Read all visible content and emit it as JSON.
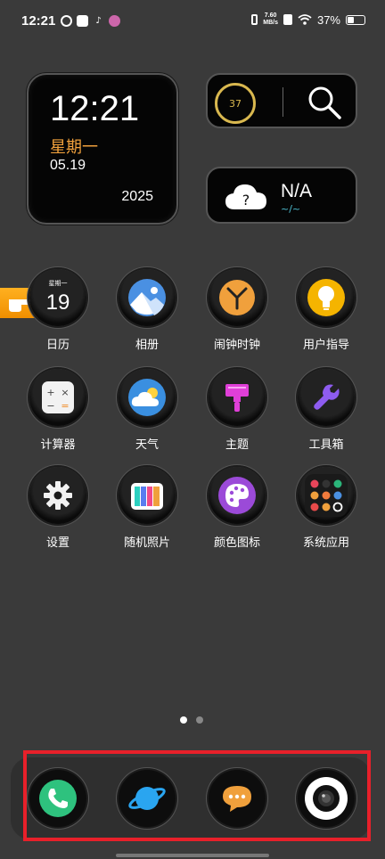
{
  "status_bar": {
    "time": "12:21",
    "net_speed_value": "7.60",
    "net_speed_unit": "MB/s",
    "battery": "37%",
    "battery_level": 0.37
  },
  "clock_widget": {
    "time": "12:21",
    "weekday": "星期一",
    "date": "05.19",
    "year": "2025"
  },
  "search_widget": {
    "ring_value": "37"
  },
  "weather_widget": {
    "icon_text": "?",
    "condition": "N/A",
    "range": "~/~"
  },
  "calendar_icon": {
    "weekday": "星期一",
    "day": "19"
  },
  "apps": [
    {
      "label": "日历"
    },
    {
      "label": "相册"
    },
    {
      "label": "闹钟时钟"
    },
    {
      "label": "用户指导"
    },
    {
      "label": "计算器"
    },
    {
      "label": "天气"
    },
    {
      "label": "主题"
    },
    {
      "label": "工具箱"
    },
    {
      "label": "设置"
    },
    {
      "label": "随机照片"
    },
    {
      "label": "颜色图标"
    },
    {
      "label": "系统应用"
    }
  ],
  "dock": {
    "apps": [
      "phone-icon",
      "browser-icon",
      "messages-icon",
      "camera-icon"
    ]
  },
  "colors": {
    "background": "#3a3a3a",
    "accent_orange": "#f0a03c",
    "highlight_red": "#e8202a"
  }
}
